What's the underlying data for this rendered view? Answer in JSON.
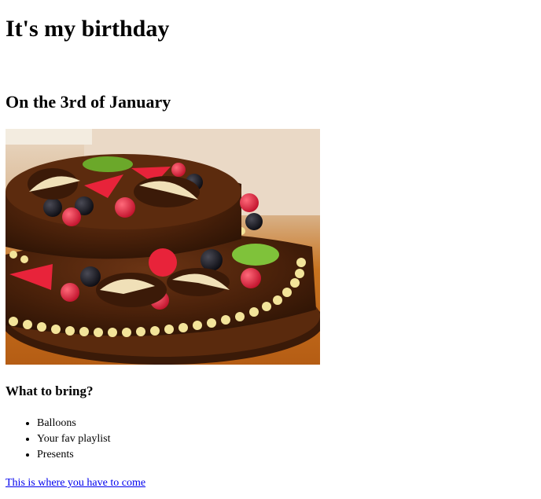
{
  "heading": "It's my birthday",
  "subheading": "On the 3rd of January",
  "image": {
    "alt": "Chocolate birthday cake with fresh berries"
  },
  "bring": {
    "title": "What to bring?",
    "items": [
      "Balloons",
      "Your fav playlist",
      "Presents"
    ]
  },
  "link": {
    "text": "This is where you have to come"
  },
  "colors": {
    "link": "#0000ee",
    "text": "#000000",
    "background": "#ffffff"
  }
}
